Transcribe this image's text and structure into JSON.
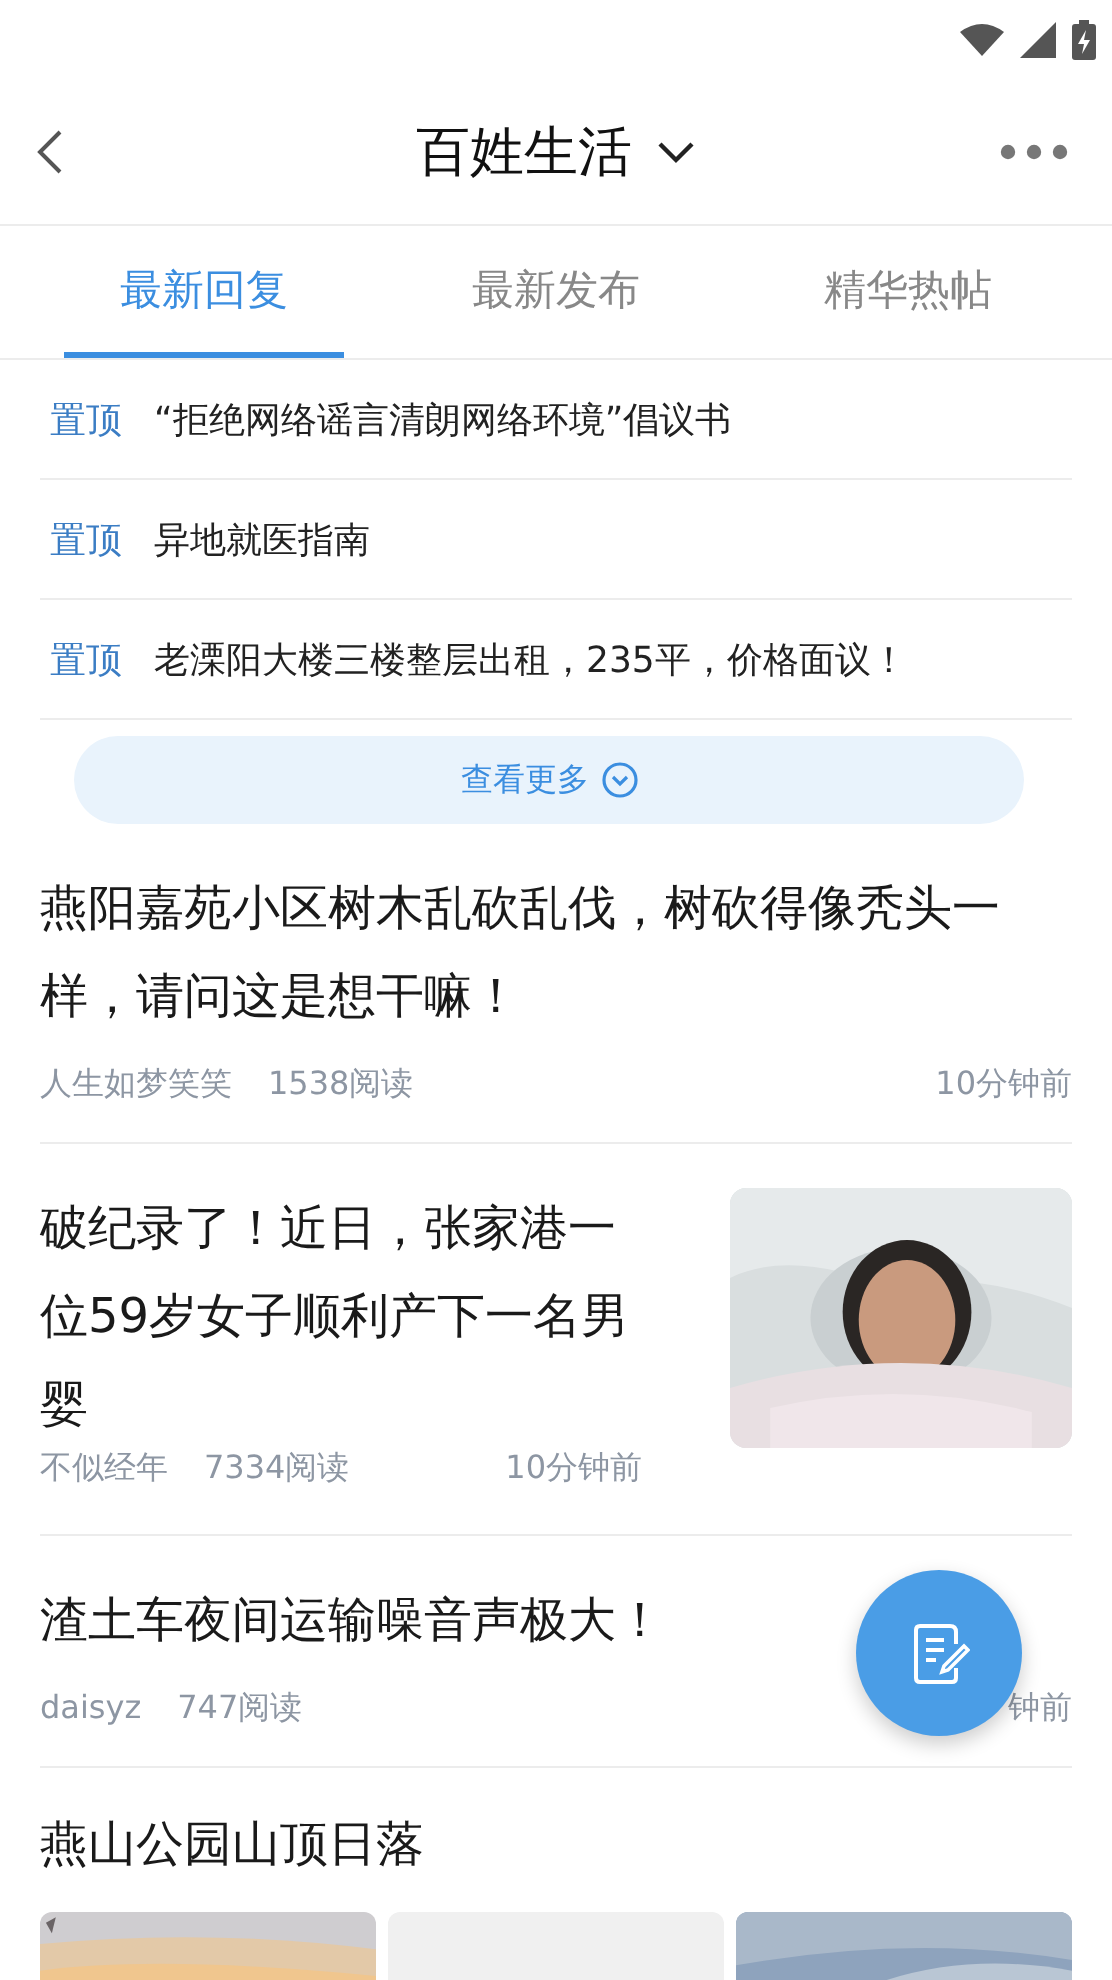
{
  "header": {
    "title": "百姓生活"
  },
  "tabs": [
    {
      "label": "最新回复",
      "selected": true
    },
    {
      "label": "最新发布",
      "selected": false
    },
    {
      "label": "精华热帖",
      "selected": false
    }
  ],
  "pinned": [
    {
      "tag": "置顶",
      "title": "“拒绝网络谣言清朗网络环境”倡议书"
    },
    {
      "tag": "置顶",
      "title": "异地就医指南"
    },
    {
      "tag": "置顶",
      "title": "老溧阳大楼三楼整层出租，235平，价格面议！"
    }
  ],
  "more_button": {
    "label": "查看更多"
  },
  "posts": [
    {
      "kind": "text",
      "title": "燕阳嘉苑小区树木乱砍乱伐，树砍得像秃头一样，请问这是想干嘛！",
      "author": "人生如梦笑笑",
      "reads": "1538阅读",
      "time": "10分钟前"
    },
    {
      "kind": "thumb",
      "title": "破纪录了！近日，张家港一位59岁女子顺利产下一名男婴",
      "author": "不似经年",
      "reads": "7334阅读",
      "time": "10分钟前"
    },
    {
      "kind": "text",
      "title": "渣土车夜间运输噪音声极大！",
      "author": "daisyz",
      "reads": "747阅读",
      "time": "钟前"
    },
    {
      "kind": "gallery",
      "title": "燕山公园山顶日落"
    }
  ]
}
